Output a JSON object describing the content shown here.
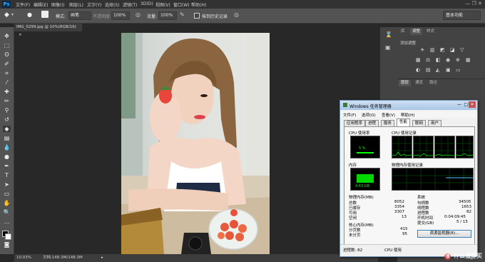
{
  "app": {
    "logo": "Ps"
  },
  "menubar": {
    "items": [
      "文件(F)",
      "编辑(E)",
      "图像(I)",
      "图层(L)",
      "文字(Y)",
      "选择(S)",
      "滤镜(T)",
      "3D(D)",
      "视图(V)",
      "窗口(W)",
      "帮助(H)"
    ]
  },
  "options": {
    "mode_label": "模式:",
    "mode_value": "画笔",
    "opacity_label": "不透明度:",
    "opacity_value": "100%",
    "flow_label": "流量:",
    "flow_value": "100%",
    "history_label": "抹到历史记录",
    "workspace": "基本功能"
  },
  "document": {
    "tab_title": "IMG_0299.jpg @ 10%(RGB/16)",
    "zoom": "10.03%",
    "doc_info": "文档:148.3M/148.3M"
  },
  "dock": {
    "tabs_top": [
      "库",
      "调整",
      "样式"
    ],
    "adjust_label": "添加调整",
    "tabs_bottom": [
      "图层",
      "通道",
      "路径"
    ]
  },
  "taskmanager": {
    "title": "Windows 任务管理器",
    "menu": [
      "文件(F)",
      "选项(O)",
      "查看(V)",
      "帮助(H)"
    ],
    "tabs": [
      "应用程序",
      "进程",
      "服务",
      "性能",
      "联网",
      "用户"
    ],
    "active_tab": "性能",
    "cpu_usage_label": "CPU 使用率",
    "cpu_usage_value": "5 %",
    "cpu_history_label": "CPU 使用记录",
    "mem_label": "内存",
    "mem_value": "4.63 GB",
    "mem_history_label": "物理内存使用记录",
    "physical_mem_label": "物理内存(MB)",
    "physical_mem": [
      [
        "总数",
        "8052"
      ],
      [
        "已缓存",
        "3354"
      ],
      [
        "可用",
        "3307"
      ],
      [
        "空闲",
        "13"
      ]
    ],
    "kernel_mem_label": "核心内存(MB)",
    "kernel_mem": [
      [
        "分页数",
        "415"
      ],
      [
        "未分页",
        "95"
      ]
    ],
    "system_label": "系统",
    "system": [
      [
        "句柄数",
        "34505"
      ],
      [
        "线程数",
        "1653"
      ],
      [
        "进程数",
        "82"
      ],
      [
        "开机时间",
        "0:04:09:45"
      ],
      [
        "提交(GB)",
        "5 / 15"
      ]
    ],
    "resource_button": "资源监视器(R)...",
    "status_processes": "进程数: 82",
    "status_cpu": "CPU 使用"
  },
  "watermark": "值 什么值得买",
  "colors": {
    "ps_bg": "#282828",
    "panel": "#535353",
    "accent": "#31a8ff",
    "graph_green": "#00ff00"
  }
}
